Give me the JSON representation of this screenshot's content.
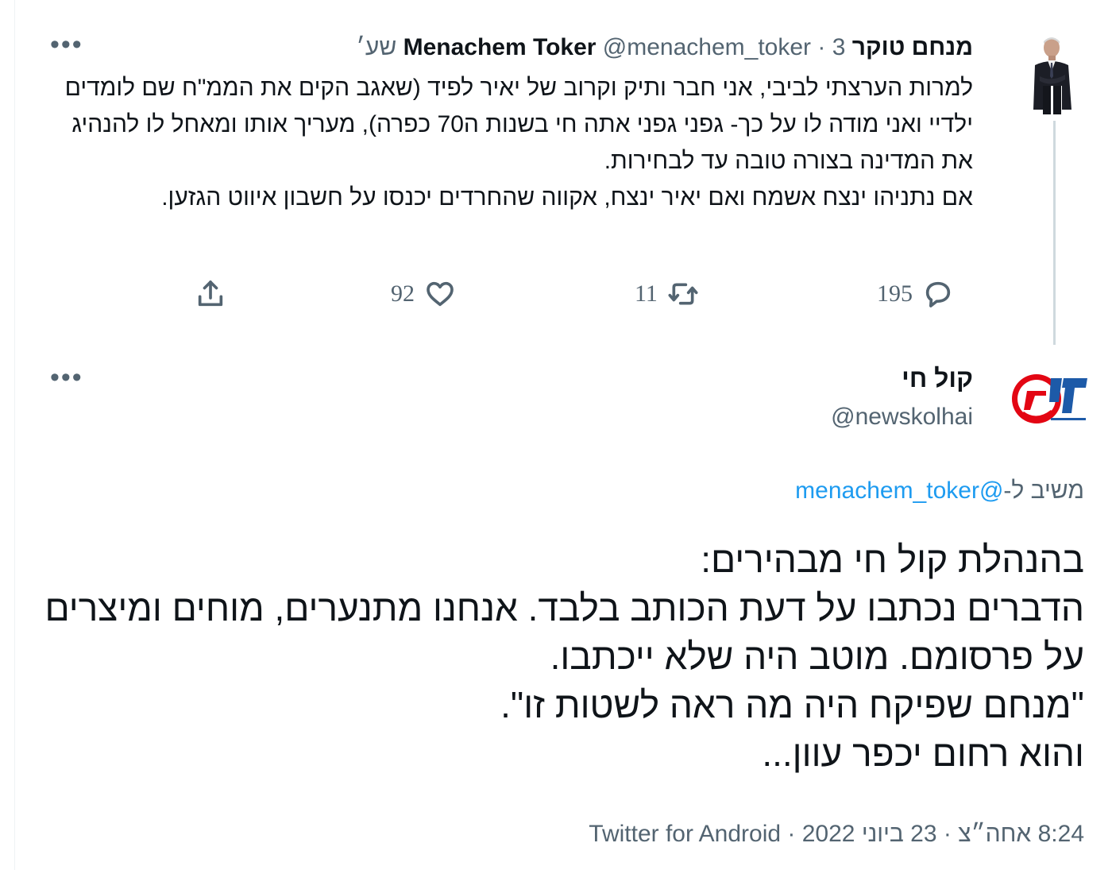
{
  "parent_tweet": {
    "author_name": "מנחם טוקר Menachem Toker",
    "handle": "@menachem_toker",
    "separator": "·",
    "time": "3 שע׳",
    "more_label": "•••",
    "text": "למרות הערצתי לביבי, אני חבר ותיק וקרוב של יאיר לפיד (שאגב הקים את הממ\"ח שם לומדים ילדיי ואני מודה לו על כך- גפני גפני אתה חי בשנות ה70 כפרה), מעריך אותו ומאחל לו להנהיג את המדינה בצורה טובה עד לבחירות.\nאם נתניהו ינצח אשמח ואם יאיר ינצח, אקווה שהחרדים יכנסו על חשבון איווט הגזען.",
    "replies": "195",
    "retweets": "11",
    "likes": "92",
    "icons": {
      "reply": "reply-icon",
      "retweet": "retweet-icon",
      "like": "like-icon",
      "share": "share-icon"
    }
  },
  "main_tweet": {
    "author_name": "קול חי",
    "handle": "@newskolhai",
    "more_label": "•••",
    "reply_prefix": "משיב ל-",
    "reply_to": "@menachem_toker",
    "text": "בהנהלת קול חי מבהירים:\nהדברים נכתבו על דעת הכותב בלבד. אנחנו מתנערים, מוחים ומיצרים על פרסומם. מוטב היה שלא ייכתבו.\n\"מנחם שפיקח היה מה ראה לשטות זו\".\nוהוא רחום יכפר עוון...",
    "time": "8:24 אחה״צ",
    "date": "23 ביוני 2022",
    "source": "Twitter for Android",
    "separator": "·",
    "logo_text": "קול",
    "logo_color": "#e30613",
    "logo_blue": "#1d5aa8"
  }
}
